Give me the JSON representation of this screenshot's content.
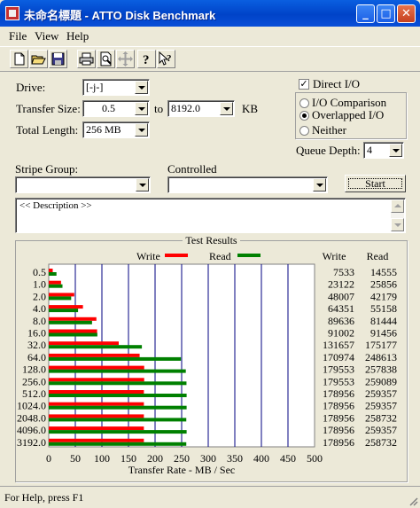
{
  "titlebar": {
    "title": "未命名標題 - ATTO Disk Benchmark",
    "minimize": "_",
    "maximize": "□",
    "close": "✕"
  },
  "menu": [
    "File",
    "View",
    "Help"
  ],
  "toolbar": [
    "new-icon",
    "open-icon",
    "save-icon",
    "print-icon",
    "print-preview-icon",
    "move-icon",
    "help-icon",
    "context-help-icon"
  ],
  "form": {
    "drive_label": "Drive:",
    "drive_value": "[-j-]",
    "transfer_size_label": "Transfer Size:",
    "transfer_from": "0.5",
    "to_label": "to",
    "transfer_to": "8192.0",
    "kb_label": "KB",
    "total_length_label": "Total Length:",
    "total_length_value": "256 MB",
    "direct_io_label": "Direct I/O",
    "direct_io_checked": true,
    "io_comparison_label": "I/O Comparison",
    "overlapped_io_label": "Overlapped I/O",
    "neither_label": "Neither",
    "selected_mode": "Overlapped I/O",
    "queue_depth_label": "Queue Depth:",
    "queue_depth_value": "4",
    "stripe_group_label": "Stripe Group:",
    "stripe_group_value": "",
    "controlled_label": "Controlled",
    "controlled_value": "",
    "start_label": "Start",
    "description": "<< Description >>"
  },
  "results": {
    "title": "Test Results",
    "write_legend": "Write",
    "read_legend": "Read",
    "write_header": "Write",
    "read_header": "Read"
  },
  "chart_data": {
    "type": "bar",
    "orientation": "horizontal",
    "categories": [
      "0.5",
      "1.0",
      "2.0",
      "4.0",
      "8.0",
      "16.0",
      "32.0",
      "64.0",
      "128.0",
      "256.0",
      "512.0",
      "1024.0",
      "2048.0",
      "4096.0",
      "3192.0"
    ],
    "series": [
      {
        "name": "Write",
        "color": "#ff0000",
        "values": [
          7533,
          23122,
          48007,
          64351,
          89636,
          91002,
          131657,
          170974,
          179553,
          179553,
          178956,
          178956,
          178956,
          178956,
          178956
        ]
      },
      {
        "name": "Read",
        "color": "#008000",
        "values": [
          14555,
          25856,
          42179,
          55158,
          81444,
          91456,
          175177,
          248613,
          257838,
          259089,
          259357,
          259357,
          258732,
          259357,
          258732
        ]
      }
    ],
    "xticks": [
      "0",
      "50",
      "100",
      "150",
      "200",
      "250",
      "300",
      "350",
      "400",
      "450",
      "500"
    ],
    "xlim": [
      0,
      500
    ],
    "xlabel": "Transfer Rate - MB / Sec",
    "grid": true
  },
  "statusbar": {
    "text": "For Help, press F1"
  }
}
